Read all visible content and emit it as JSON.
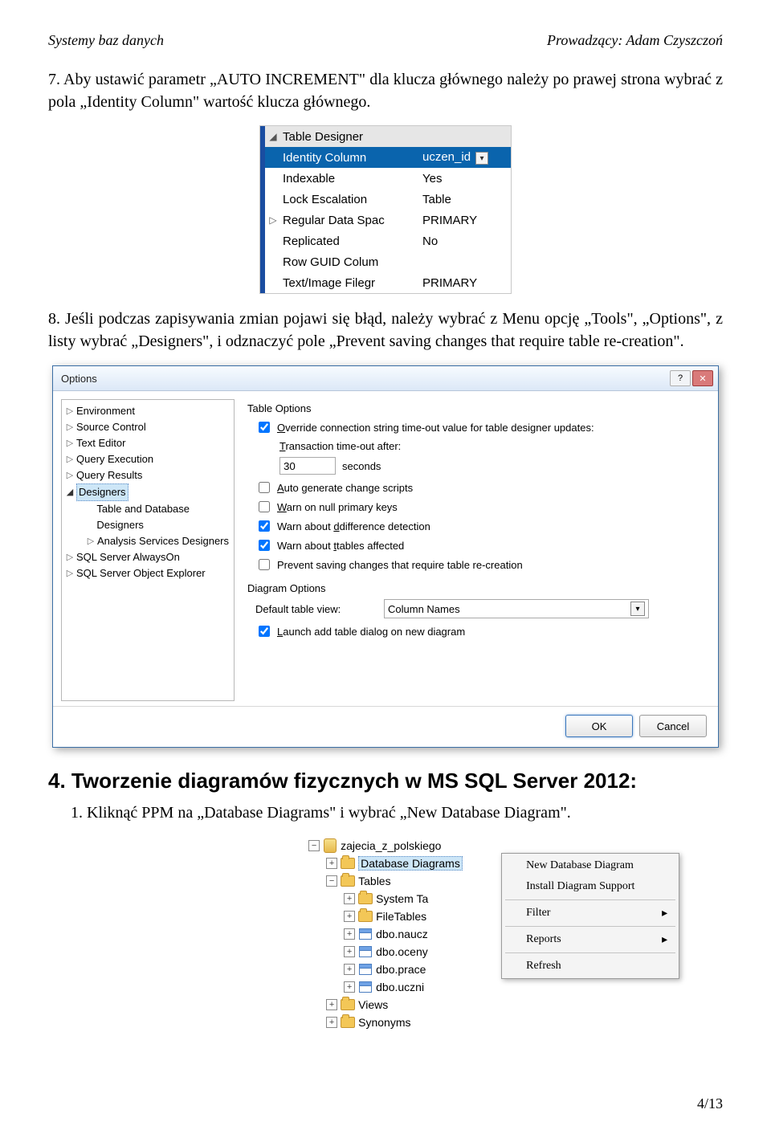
{
  "header": {
    "left": "Systemy baz danych",
    "right": "Prowadzący: Adam Czyszczoń"
  },
  "para7": "7. Aby ustawić parametr „AUTO INCREMENT\" dla klucza głównego należy po prawej strona wybrać z pola „Identity Column\" wartość klucza głównego.",
  "fig1": {
    "header": "Table Designer",
    "rows": [
      {
        "n": "Identity Column",
        "v": "uczen_id",
        "sel": true,
        "drop": true
      },
      {
        "n": "Indexable",
        "v": "Yes"
      },
      {
        "n": "Lock Escalation",
        "v": "Table"
      },
      {
        "n": "Regular Data Spac",
        "v": "PRIMARY",
        "arrow": true
      },
      {
        "n": "Replicated",
        "v": "No"
      },
      {
        "n": "Row GUID Colum",
        "v": ""
      },
      {
        "n": "Text/Image Filegr",
        "v": "PRIMARY"
      }
    ]
  },
  "para8": "8. Jeśli podczas zapisywania zmian pojawi się błąd, należy wybrać z Menu opcję „Tools\", „Options\", z listy wybrać „Designers\", i odznaczyć pole „Prevent saving changes that require table re-creation\".",
  "fig2": {
    "title": "Options",
    "tree": [
      {
        "l": "Environment",
        "t": "c"
      },
      {
        "l": "Source Control",
        "t": "c"
      },
      {
        "l": "Text Editor",
        "t": "c"
      },
      {
        "l": "Query Execution",
        "t": "c"
      },
      {
        "l": "Query Results",
        "t": "c"
      },
      {
        "l": "Designers",
        "t": "o",
        "sel": true
      },
      {
        "l": "Table and Database Designers",
        "ind": true
      },
      {
        "l": "Analysis Services Designers",
        "t": "c",
        "ind": true
      },
      {
        "l": "SQL Server AlwaysOn",
        "t": "c"
      },
      {
        "l": "SQL Server Object Explorer",
        "t": "c"
      }
    ],
    "tableOptions": "Table Options",
    "chk1": "Override connection string time-out value for table designer updates:",
    "timeoutLabel": "Transaction time-out after:",
    "timeoutVal": "30",
    "timeoutUnit": "seconds",
    "chk2": "Auto generate change scripts",
    "chk3": "Warn on null primary keys",
    "chk4": "Warn about difference detection",
    "chk5": "Warn about tables affected",
    "chk6": "Prevent saving changes that require table re-creation",
    "diagOptions": "Diagram Options",
    "defaultView": "Default table view:",
    "defaultViewVal": "Column Names",
    "chk7": "Launch add table dialog on new diagram",
    "ok": "OK",
    "cancel": "Cancel"
  },
  "section4": "4. Tworzenie diagramów fizycznych w MS SQL Server 2012:",
  "step1": "1. Kliknąć PPM na „Database Diagrams\" i wybrać „New Database Diagram\".",
  "fig3": {
    "db": "zajecia_z_polskiego",
    "sel": "Database Diagrams",
    "nodes": [
      "Tables",
      "System Ta",
      "FileTables",
      "dbo.naucz",
      "dbo.oceny",
      "dbo.prace",
      "dbo.uczni",
      "Views",
      "Synonyms"
    ],
    "menu": [
      "New Database Diagram",
      "Install Diagram Support",
      "Filter",
      "Reports",
      "Refresh"
    ]
  },
  "pagenum": "4/13"
}
